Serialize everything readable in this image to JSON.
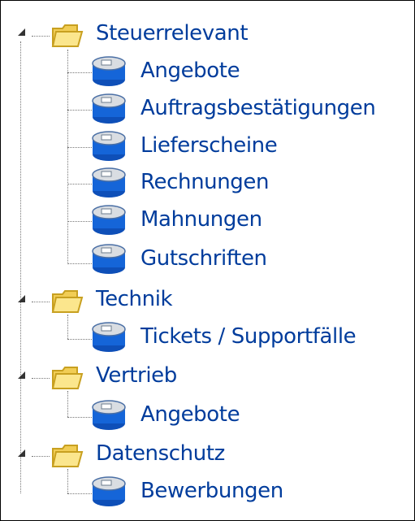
{
  "tree": {
    "groups": [
      {
        "label": "Steuerrelevant",
        "icon": "folder-icon",
        "expanded": true,
        "children": [
          {
            "label": "Angebote",
            "icon": "database-icon"
          },
          {
            "label": "Auftragsbestätigungen",
            "icon": "database-icon"
          },
          {
            "label": "Lieferscheine",
            "icon": "database-icon"
          },
          {
            "label": "Rechnungen",
            "icon": "database-icon"
          },
          {
            "label": "Mahnungen",
            "icon": "database-icon"
          },
          {
            "label": "Gutschriften",
            "icon": "database-icon"
          }
        ]
      },
      {
        "label": "Technik",
        "icon": "folder-icon",
        "expanded": true,
        "children": [
          {
            "label": "Tickets / Supportfälle",
            "icon": "database-icon"
          }
        ]
      },
      {
        "label": "Vertrieb",
        "icon": "folder-icon",
        "expanded": true,
        "children": [
          {
            "label": "Angebote",
            "icon": "database-icon"
          }
        ]
      },
      {
        "label": "Datenschutz",
        "icon": "folder-icon",
        "expanded": true,
        "children": [
          {
            "label": "Bewerbungen",
            "icon": "database-icon"
          }
        ]
      }
    ]
  },
  "colors": {
    "label_text": "#003c9c",
    "folder_fill": "#f7d96a",
    "folder_edge": "#c8a020",
    "db_fill": "#1565d8",
    "db_top": "#d9dde2"
  }
}
